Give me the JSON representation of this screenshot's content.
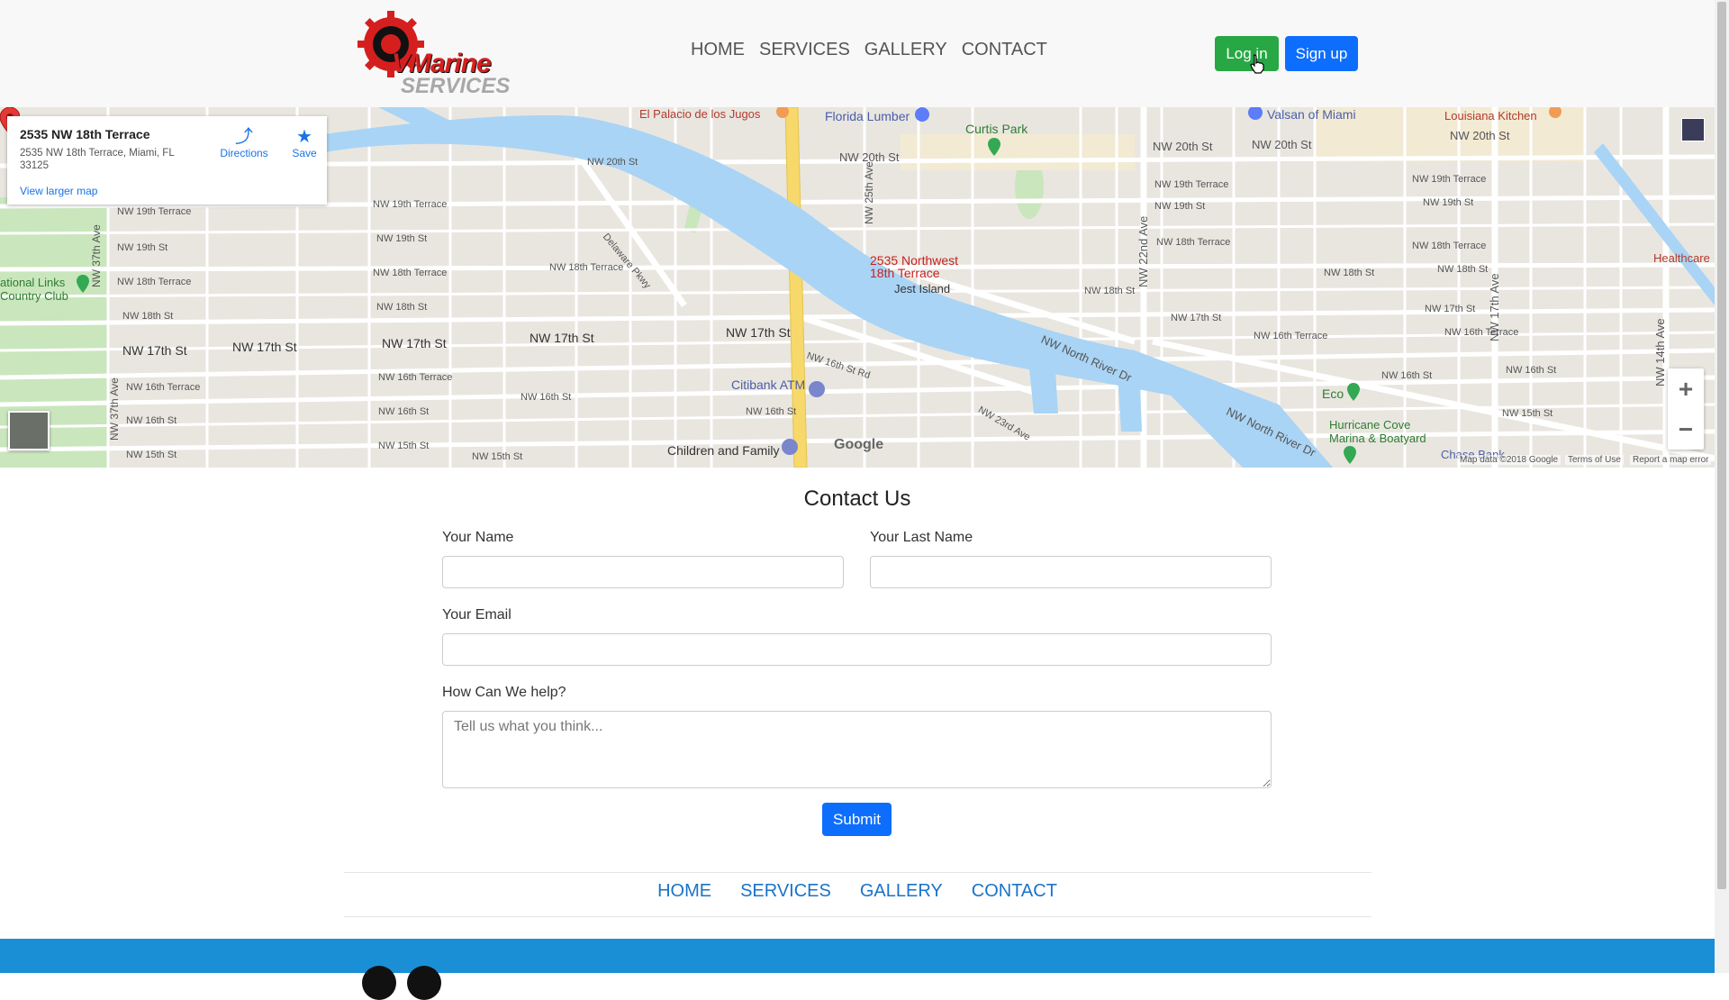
{
  "header": {
    "logo_text_main": "VMarine",
    "logo_text_sub": "SERVICES",
    "nav": [
      "HOME",
      "SERVICES",
      "GALLERY",
      "CONTACT"
    ],
    "login_label": "Log in",
    "signup_label": "Sign up"
  },
  "map": {
    "card": {
      "title": "2535 NW 18th Terrace",
      "address": "2535 NW 18th Terrace, Miami, FL 33125",
      "directions": "Directions",
      "save": "Save",
      "larger_map": "View larger map"
    },
    "pin_label_line1": "2535 Northwest",
    "pin_label_line2": "18th Terrace",
    "places": {
      "palacio": "El Palacio de los Jugos",
      "florida_lumber": "Florida Lumber",
      "valsan": "Valsan of Miami",
      "louisiana": "Louisiana Kitchen",
      "curtis": "Curtis Park",
      "jest_island": "Jest Island",
      "links_1": "ational Links",
      "links_2": "Country Club",
      "citibank": "Citibank ATM",
      "children": "Children and Family",
      "eco": "Eco",
      "hurricane_1": "Hurricane Cove",
      "hurricane_2": "Marina & Boatyard",
      "chase": "Chase Bank",
      "healthcare": "Healthcare"
    },
    "streets": {
      "nw20": "NW 20th St",
      "nw19": "NW 19th St",
      "nw19t": "NW 19th Terrace",
      "nw18": "NW 18th St",
      "nw18t": "NW 18th Terrace",
      "nw17": "NW 17th St",
      "nw16": "NW 16th St",
      "nw16t": "NW 16th Terrace",
      "nw15": "NW 15th St",
      "nw37": "NW 37th Ave",
      "nw22": "NW 22nd Ave",
      "nw17a": "NW 17th Ave",
      "nw14a": "NW 14th Ave",
      "nw25": "NW 25th Ave",
      "river": "NW North River Dr",
      "delaware": "Delaware Pkwy",
      "nw16r": "NW 16th St Rd",
      "nw23": "NW 23rd Ave"
    },
    "zoom_in": "+",
    "zoom_out": "−",
    "google": "Google",
    "attr_data": "Map data ©2018 Google",
    "attr_terms": "Terms of Use",
    "attr_report": "Report a map error"
  },
  "form": {
    "title": "Contact Us",
    "first_name_label": "Your Name",
    "last_name_label": "Your Last Name",
    "email_label": "Your Email",
    "help_label": "How Can We help?",
    "help_placeholder": "Tell us what you think...",
    "submit_label": "Submit"
  },
  "footer_nav": [
    "HOME",
    "SERVICES",
    "GALLERY",
    "CONTACT"
  ],
  "colors": {
    "login": "#28a745",
    "primary": "#0d6efd",
    "footer": "#1a8fd6",
    "water": "#a9d4f5"
  }
}
